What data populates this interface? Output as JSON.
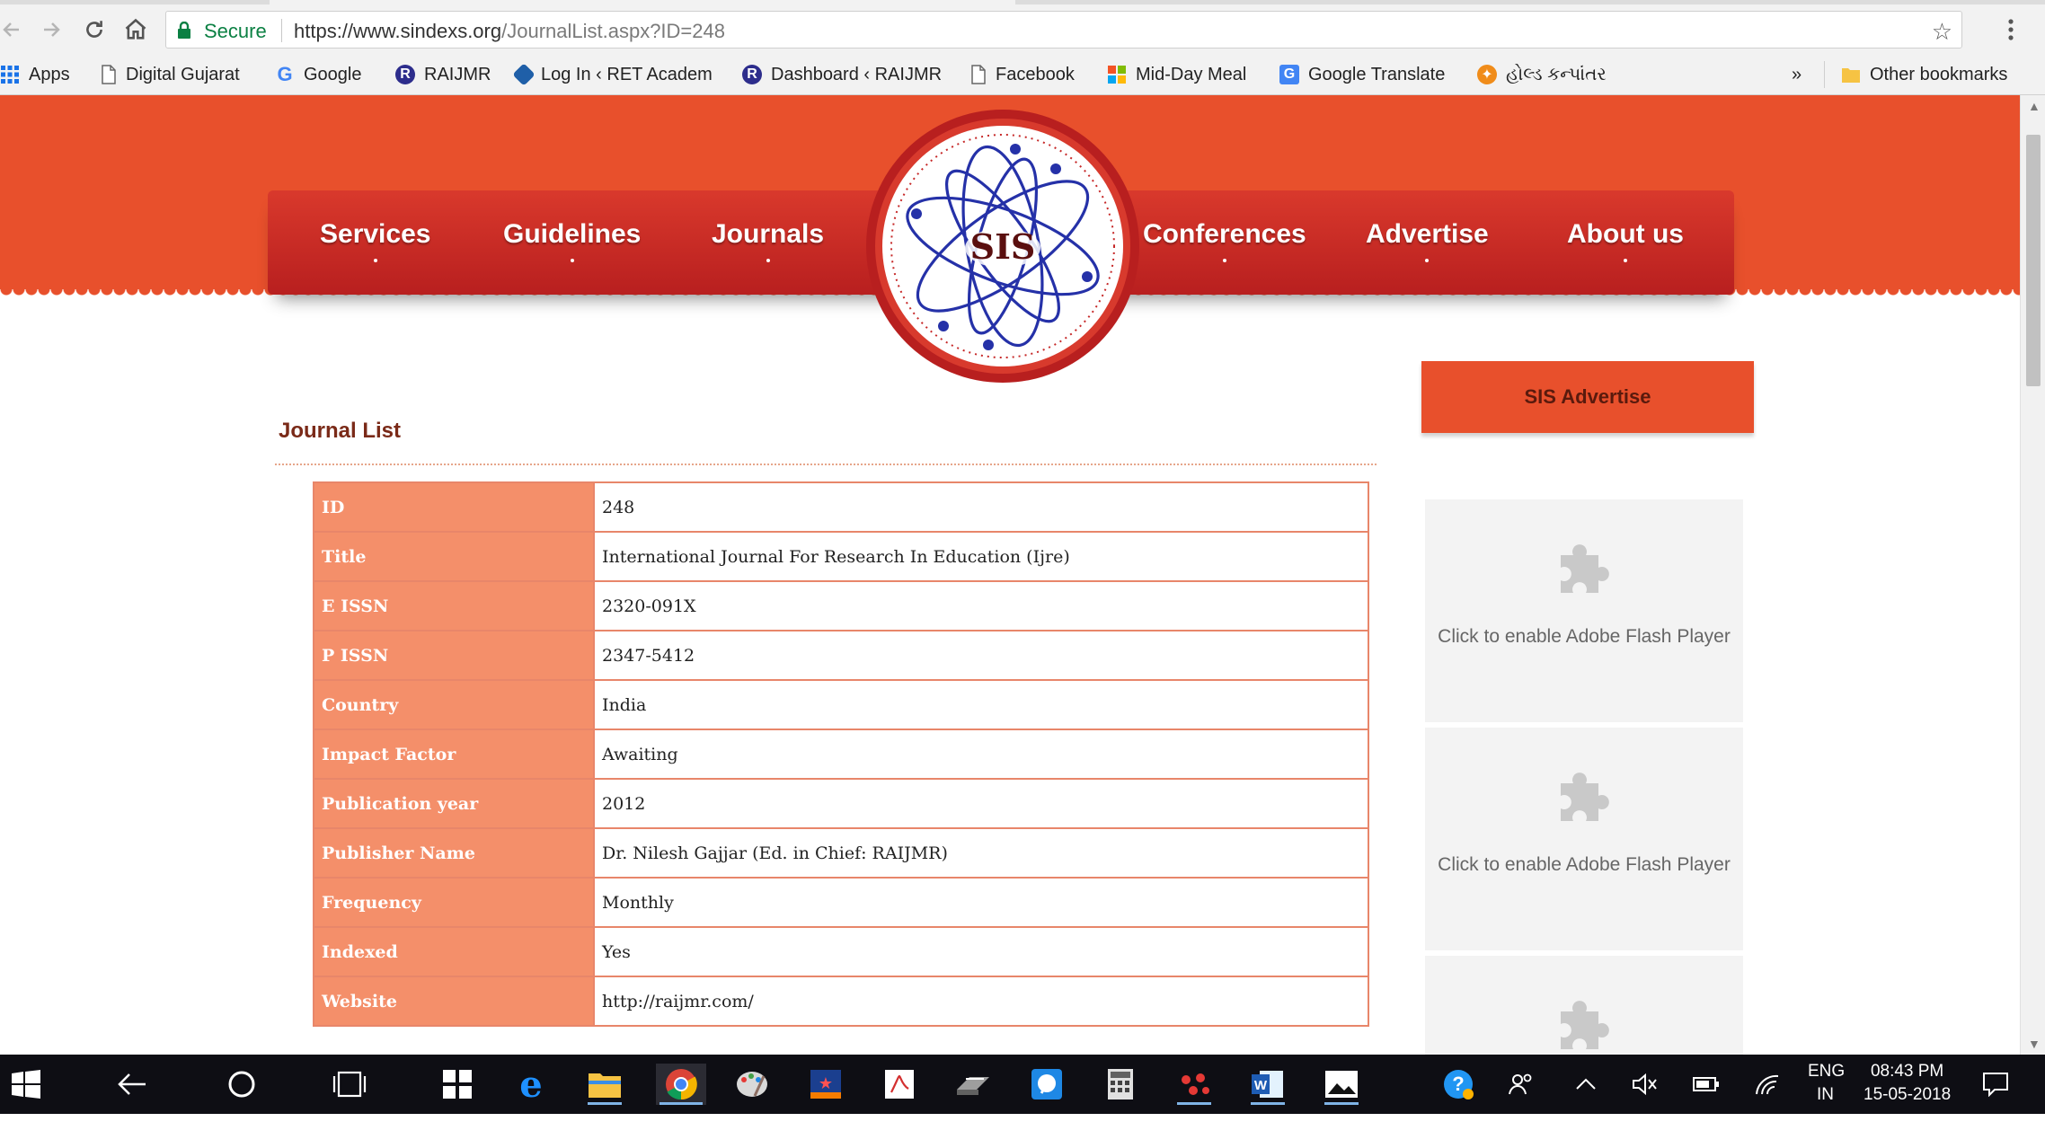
{
  "browser": {
    "secure_label": "Secure",
    "url_host": "https://www.sindexs.org",
    "url_path": "/JournalList.aspx?ID=248",
    "bookmarks": [
      {
        "label": "Apps",
        "icon": "apps-grid-icon"
      },
      {
        "label": "Digital Gujarat",
        "icon": "page-icon"
      },
      {
        "label": "Google",
        "icon": "google-icon"
      },
      {
        "label": "RAIJMR",
        "icon": "raijmr-icon"
      },
      {
        "label": "Log In ‹ RET Academ",
        "icon": "ret-icon"
      },
      {
        "label": "Dashboard ‹ RAIJMR",
        "icon": "raijmr-icon"
      },
      {
        "label": "Facebook",
        "icon": "page-icon"
      },
      {
        "label": "Mid-Day Meal",
        "icon": "windows-flag-icon"
      },
      {
        "label": "Google Translate",
        "icon": "translate-icon"
      },
      {
        "label": "હોલ્ડ કન્પાંતર",
        "icon": "paw-icon"
      }
    ],
    "overflow_label": "»",
    "other_bookmarks": "Other bookmarks"
  },
  "site": {
    "nav": [
      {
        "label": "Services"
      },
      {
        "label": "Guidelines"
      },
      {
        "label": "Journals"
      },
      {
        "label": "Conferences"
      },
      {
        "label": "Advertise"
      },
      {
        "label": "About us"
      }
    ],
    "logo_text": "SIS",
    "section_title": "Journal List",
    "journal": [
      {
        "key": "ID",
        "value": "248"
      },
      {
        "key": "Title",
        "value": "International Journal For Research In Education (Ijre)"
      },
      {
        "key": "E ISSN",
        "value": "2320-091X"
      },
      {
        "key": "P ISSN",
        "value": "2347-5412"
      },
      {
        "key": "Country",
        "value": "India"
      },
      {
        "key": "Impact Factor",
        "value": "Awaiting"
      },
      {
        "key": "Publication year",
        "value": "2012"
      },
      {
        "key": "Publisher Name",
        "value": "Dr. Nilesh Gajjar (Ed. in Chief: RAIJMR)"
      },
      {
        "key": "Frequency",
        "value": "Monthly"
      },
      {
        "key": "Indexed",
        "value": "Yes"
      },
      {
        "key": "Website",
        "value": "http://raijmr.com/"
      }
    ],
    "advertise_button": "SIS Advertise",
    "flash_message": "Click to enable Adobe Flash Player"
  },
  "colors": {
    "banner": "#e8502c",
    "nav_red": "#c62828",
    "table_key_bg": "#f48f6a",
    "table_border": "#e8866a"
  },
  "taskbar": {
    "lang_top": "ENG",
    "lang_bottom": "IN",
    "time": "08:43 PM",
    "date": "15-05-2018"
  }
}
